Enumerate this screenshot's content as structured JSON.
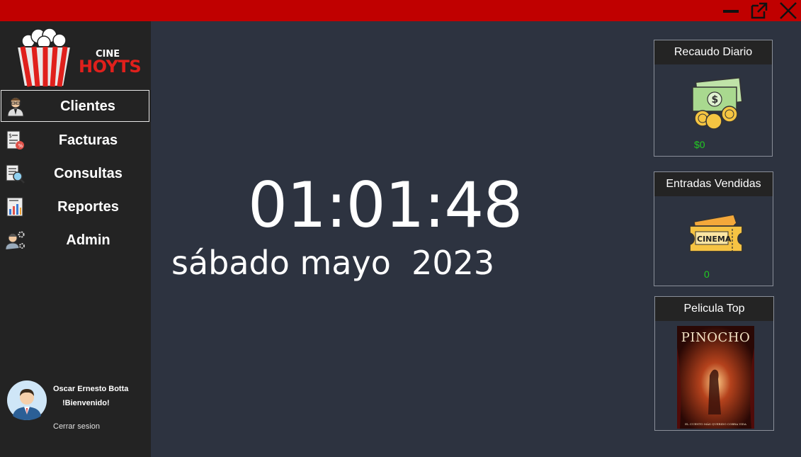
{
  "window": {
    "minimize_label": "minimize",
    "maximize_label": "maximize",
    "close_label": "close"
  },
  "brand": {
    "line1": "CINE",
    "line2": "HOYTS"
  },
  "sidebar": {
    "items": [
      {
        "label": "Clientes",
        "icon": "clients-icon",
        "active": true
      },
      {
        "label": "Facturas",
        "icon": "invoice-icon",
        "active": false
      },
      {
        "label": "Consultas",
        "icon": "search-document-icon",
        "active": false
      },
      {
        "label": "Reportes",
        "icon": "report-chart-icon",
        "active": false
      },
      {
        "label": "Admin",
        "icon": "admin-gear-icon",
        "active": false
      }
    ]
  },
  "user": {
    "name": "Oscar Ernesto Botta",
    "welcome": "!Bienvenido!",
    "logout": "Cerrar sesion"
  },
  "clock": {
    "time": "01:01:48",
    "date": "sábado mayo  2023"
  },
  "cards": {
    "revenue": {
      "title": "Recaudo Diario",
      "value": "$0",
      "icon": "money-icon"
    },
    "tickets": {
      "title": "Entradas Vendidas",
      "value": "0",
      "icon": "cinema-ticket-icon"
    },
    "top_movie": {
      "title": "Pelicula Top",
      "poster_title": "PINOCHO",
      "poster_tagline": "EL CUENTO MÁS QUERIDO COBRA VIDA"
    }
  },
  "colors": {
    "titlebar": "#c00000",
    "sidebar": "#232323",
    "main": "#2d3340",
    "value_green": "#22cc22"
  }
}
